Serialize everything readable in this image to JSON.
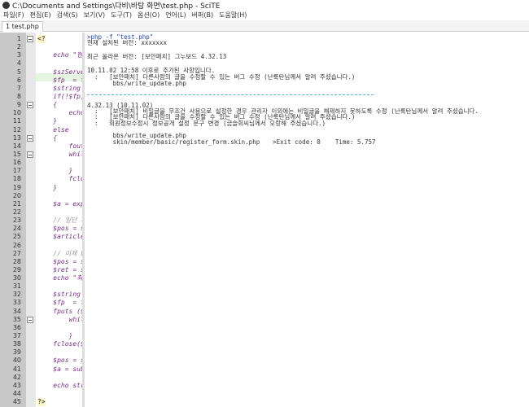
{
  "window": {
    "title": "C:\\Documents and Settings\\다비\\바탕 화면\\test.php - SciTE"
  },
  "menu": [
    "파일(F)",
    "편집(E)",
    "검색(S)",
    "보기(V)",
    "도구(T)",
    "옵션(O)",
    "언어(L)",
    "버퍼(B)",
    "도움말(H)"
  ],
  "tab": {
    "label": "1 test.php"
  },
  "editor": {
    "lines": [
      {
        "n": "1",
        "t": "<?",
        "c": "php",
        "fold": true
      },
      {
        "n": "2",
        "t": "",
        "c": ""
      },
      {
        "n": "3",
        "t": "    echo \"현재",
        "c": "kw"
      },
      {
        "n": "4",
        "t": "",
        "c": ""
      },
      {
        "n": "5",
        "t": "    $szServer",
        "c": ""
      },
      {
        "n": "6",
        "t": "    $fp  = fs",
        "c": ""
      },
      {
        "n": "7",
        "t": "    $string =",
        "c": ""
      },
      {
        "n": "8",
        "t": "    if(!$fp)",
        "c": ""
      },
      {
        "n": "9",
        "t": "    {",
        "c": "",
        "fold": true
      },
      {
        "n": "10",
        "t": "        echo \"",
        "c": "kw"
      },
      {
        "n": "11",
        "t": "    }",
        "c": ""
      },
      {
        "n": "12",
        "t": "    else",
        "c": ""
      },
      {
        "n": "13",
        "t": "    {",
        "c": "",
        "fold": true
      },
      {
        "n": "14",
        "t": "        fouts",
        "c": ""
      },
      {
        "n": "15",
        "t": "        while",
        "c": "",
        "fold": true
      },
      {
        "n": "16",
        "t": "            $.",
        "c": ""
      },
      {
        "n": "17",
        "t": "        }",
        "c": ""
      },
      {
        "n": "18",
        "t": "        fclose",
        "c": ""
      },
      {
        "n": "19",
        "t": "    }",
        "c": ""
      },
      {
        "n": "20",
        "t": "",
        "c": ""
      },
      {
        "n": "21",
        "t": "    $a = expl",
        "c": ""
      },
      {
        "n": "22",
        "t": "",
        "c": ""
      },
      {
        "n": "23",
        "t": "    // 일단 저",
        "c": "cm"
      },
      {
        "n": "24",
        "t": "    $pos = st",
        "c": ""
      },
      {
        "n": "25",
        "t": "    $articleN",
        "c": ""
      },
      {
        "n": "26",
        "t": "",
        "c": ""
      },
      {
        "n": "27",
        "t": "    // 이제 b",
        "c": "cm"
      },
      {
        "n": "28",
        "t": "    $pos = st",
        "c": ""
      },
      {
        "n": "29",
        "t": "    $ret = su",
        "c": ""
      },
      {
        "n": "30",
        "t": "    echo \"최근",
        "c": "kw"
      },
      {
        "n": "31",
        "t": "",
        "c": ""
      },
      {
        "n": "32",
        "t": "    $string =",
        "c": ""
      },
      {
        "n": "33",
        "t": "    $fp  = fs",
        "c": ""
      },
      {
        "n": "34",
        "t": "    fputs ($f",
        "c": ""
      },
      {
        "n": "35",
        "t": "        while",
        "c": "",
        "fold": true
      },
      {
        "n": "36",
        "t": "            $.",
        "c": ""
      },
      {
        "n": "37",
        "t": "        }",
        "c": ""
      },
      {
        "n": "38",
        "t": "    fclose($f",
        "c": ""
      },
      {
        "n": "39",
        "t": "",
        "c": ""
      },
      {
        "n": "40",
        "t": "    $pos = st",
        "c": ""
      },
      {
        "n": "41",
        "t": "    $a = subs",
        "c": ""
      },
      {
        "n": "42",
        "t": "",
        "c": ""
      },
      {
        "n": "43",
        "t": "    echo str_",
        "c": "kw"
      },
      {
        "n": "44",
        "t": "",
        "c": ""
      },
      {
        "n": "45",
        "t": "?>",
        "c": "php"
      }
    ]
  },
  "output": {
    "command": ">php -f \"test.php\"",
    "installed": "현재 설치된 버전: xxxxxxx",
    "latest": "최근 올라온 버전: [보안패치] 그누보드 4.32.13",
    "block1_header": "10.11.02 12:58 이후로 추가된 사항입니다.",
    "block1_item": "  :   [보안패치] 다른사람의 글을 수정할 수 있는 버그 수정 (난룩탄님께서 알려 주셨습니다.)",
    "block1_file": "       bbs/write_update.php",
    "block2_header": "4.32.13 (10.11.02)",
    "block2_items": [
      "  :   [보안패치] 비밀글을 무조건 사용으로 설정한 경우 관리자 이외에는 비밀글을 해제하지 못하도록 수정 (난룩탄님께서 알려 주셨습니다.",
      "  :   [보안패치] 다른사람의 글을 수정할 수 있는 버그 수정 (난룩탄님께서 알려 주셨습니다.)",
      "  :   회원정보수정시 정보공개 설정 문구 변경 (금슬회씨님께서 오랑해 주셨습니다.)"
    ],
    "block2_files": [
      "       bbs/write_update.php",
      "       skin/member/basic/register_form.skin.php"
    ],
    "exit": "    >Exit code: 0    Time: 5.757"
  }
}
